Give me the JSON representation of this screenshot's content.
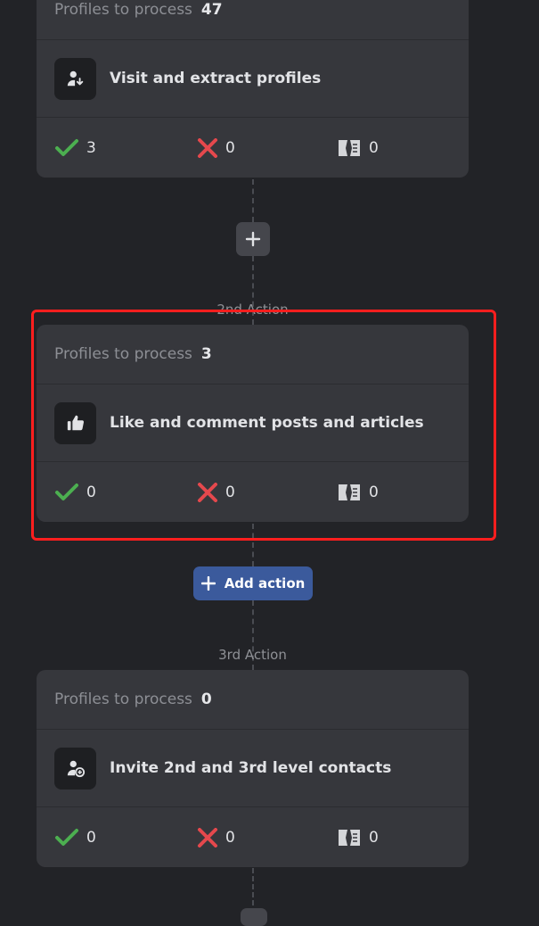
{
  "cards": [
    {
      "profiles_label": "Profiles to process",
      "profiles_count": "47",
      "action": "Visit and extract profiles",
      "icon": "person-download-icon",
      "success": "3",
      "failed": "0",
      "skipped": "0"
    },
    {
      "profiles_label": "Profiles to process",
      "profiles_count": "3",
      "action": "Like and comment posts and articles",
      "icon": "thumbs-up-icon",
      "success": "0",
      "failed": "0",
      "skipped": "0"
    },
    {
      "profiles_label": "Profiles to process",
      "profiles_count": "0",
      "action": "Invite 2nd and 3rd level contacts",
      "icon": "person-add-icon",
      "success": "0",
      "failed": "0",
      "skipped": "0"
    }
  ],
  "step_labels": {
    "second": "2nd Action",
    "third": "3rd Action"
  },
  "add_action_label": "Add action",
  "colors": {
    "background": "#222327",
    "card": "#36373c",
    "success": "#4caf50",
    "failed": "#e5484d",
    "primary_button": "#3b5a9c",
    "highlight": "#ff1e1e"
  }
}
